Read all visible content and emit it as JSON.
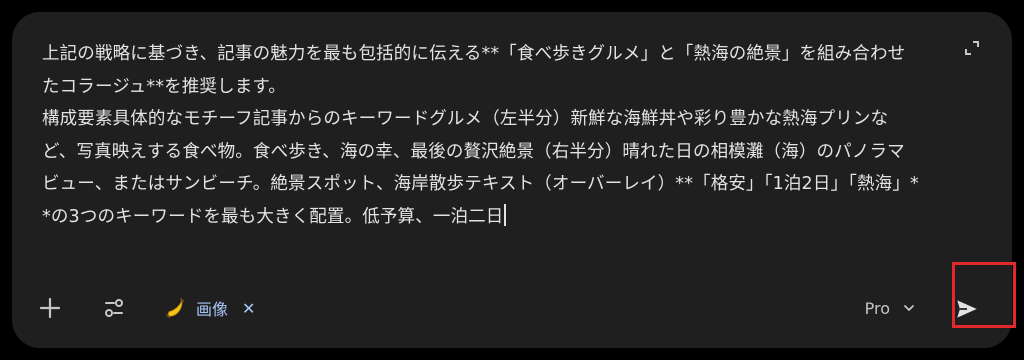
{
  "prompt": {
    "text": "上記の戦略に基づき、記事の魅力を最も包括的に伝える**「食べ歩きグルメ」と「熱海の絶景」を組み合わせたコラージュ**を推奨します。\n構成要素具体的なモチーフ記事からのキーワードグルメ（左半分）新鮮な海鮮丼や彩り豊かな熱海プリンなど、写真映えする食べ物。食べ歩き、海の幸、最後の贅沢絶景（右半分）晴れた日の相模灘（海）のパノラマビュー、またはサンビーチ。絶景スポット、海岸散歩テキスト（オーバーレイ）**「格安」「1泊2日」「熱海」**の3つのキーワードを最も大きく配置。低予算、一泊二日"
  },
  "toolbar": {
    "add_icon": "plus-icon",
    "tools_icon": "tune-icon",
    "chip": {
      "icon": "banana-icon",
      "label": "画像",
      "close_label": "✕"
    },
    "model": {
      "label": "Pro",
      "icon": "chevron-down-icon"
    },
    "send_icon": "send-icon"
  },
  "colors": {
    "background": "#000000",
    "panel": "#1f1f1f",
    "text": "#e3e3e3",
    "accent": "#a8c7fa",
    "highlight": "#e02a2a"
  }
}
